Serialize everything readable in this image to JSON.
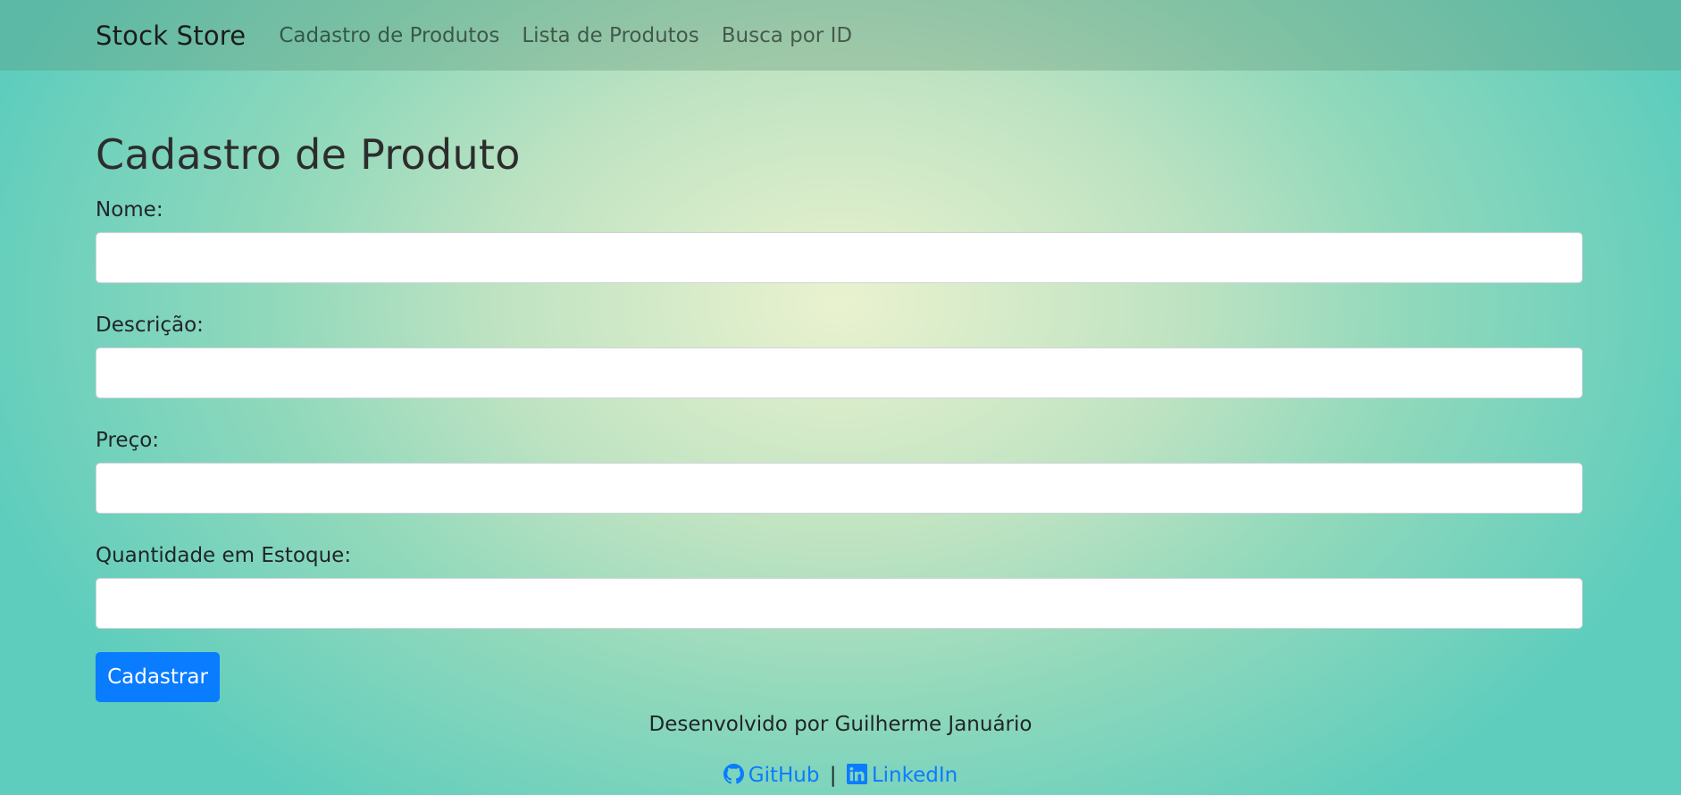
{
  "navbar": {
    "brand": "Stock Store",
    "links": [
      {
        "label": "Cadastro de Produtos"
      },
      {
        "label": "Lista de Produtos"
      },
      {
        "label": "Busca por ID"
      }
    ]
  },
  "main": {
    "title": "Cadastro de Produto",
    "fields": [
      {
        "label": "Nome:",
        "value": "",
        "placeholder": ""
      },
      {
        "label": "Descrição:",
        "value": "",
        "placeholder": ""
      },
      {
        "label": "Preço:",
        "value": "",
        "placeholder": ""
      },
      {
        "label": "Quantidade em Estoque:",
        "value": "",
        "placeholder": ""
      }
    ],
    "submit_label": "Cadastrar"
  },
  "footer": {
    "credit": "Desenvolvido por Guilherme Januário",
    "github_label": "GitHub",
    "separator": "|",
    "linkedin_label": "LinkedIn",
    "github_icon": "github-icon",
    "linkedin_icon": "linkedin-icon"
  },
  "colors": {
    "accent": "#0a7cff",
    "input_background": "#ffffff",
    "navbar_tint": "#8fb99f",
    "background_center": "#eaf2cf",
    "background_edge": "#5ecdbd"
  }
}
